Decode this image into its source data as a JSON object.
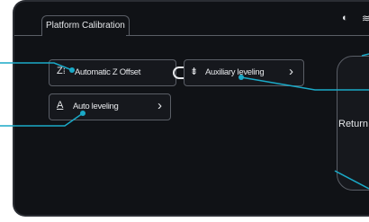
{
  "header": {
    "title": "Platform Calibration"
  },
  "status": {
    "mouse_icon": "mouse-icon",
    "wifi_icon": "wifi-icon"
  },
  "buttons": {
    "auto_z_offset": {
      "label": "Automatic Z Offset",
      "icon": "z-offset-icon",
      "toggle_on": true
    },
    "auxiliary_leveling": {
      "label": "Auxiliary leveling",
      "icon": "auxiliary-leveling-icon"
    },
    "auto_leveling": {
      "label": "Auto leveling",
      "icon": "auto-leveling-icon"
    },
    "return": {
      "label": "Return"
    }
  },
  "colors": {
    "background": "#101216",
    "accent": "#1aa9c7",
    "border": "#5a5e66",
    "text": "#e6e8eb"
  }
}
